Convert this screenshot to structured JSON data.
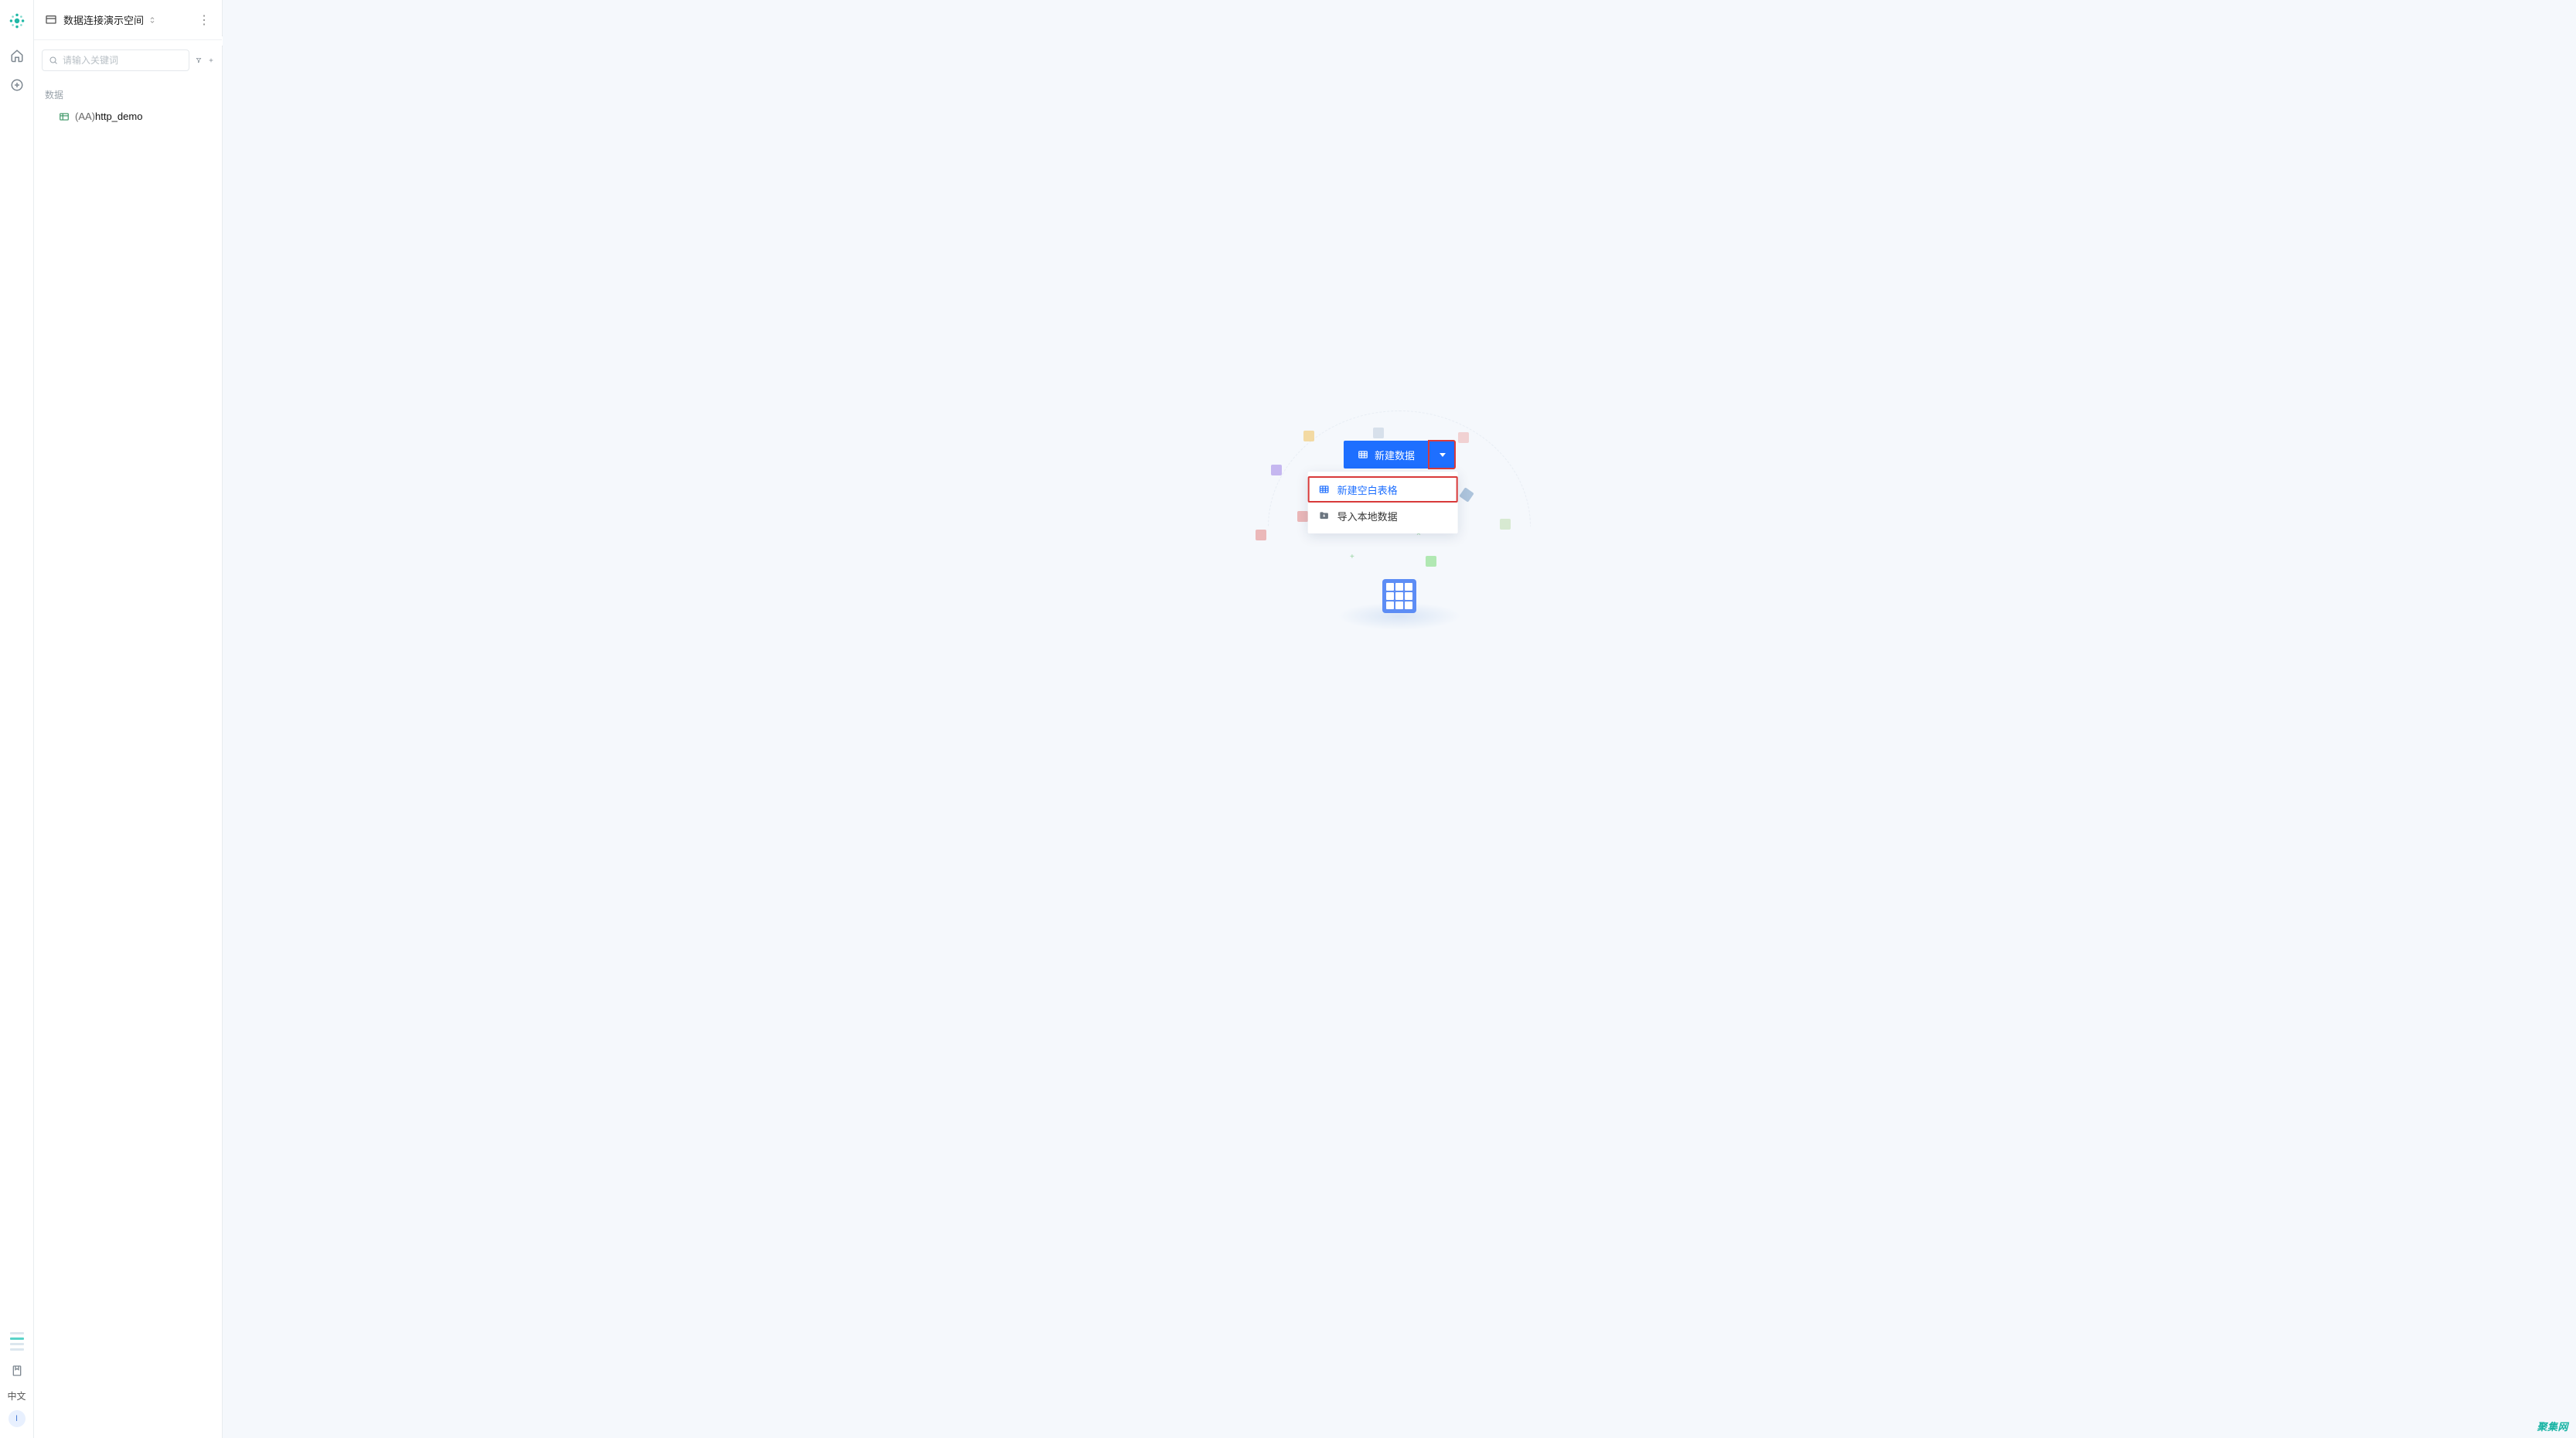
{
  "rail": {
    "lang_label": "中文",
    "avatar_initial": "I"
  },
  "sidebar": {
    "workspace_name": "数据连接演示空间",
    "search_placeholder": "请输入关键词",
    "section_title": "数据",
    "items": [
      {
        "prefix": "(AA)",
        "name": "http_demo"
      }
    ]
  },
  "cta": {
    "primary_label": "新建数据"
  },
  "menu": {
    "items": [
      {
        "label": "新建空白表格",
        "highlight": true
      },
      {
        "label": "导入本地数据",
        "highlight": false
      }
    ]
  },
  "watermark": "聚集网"
}
